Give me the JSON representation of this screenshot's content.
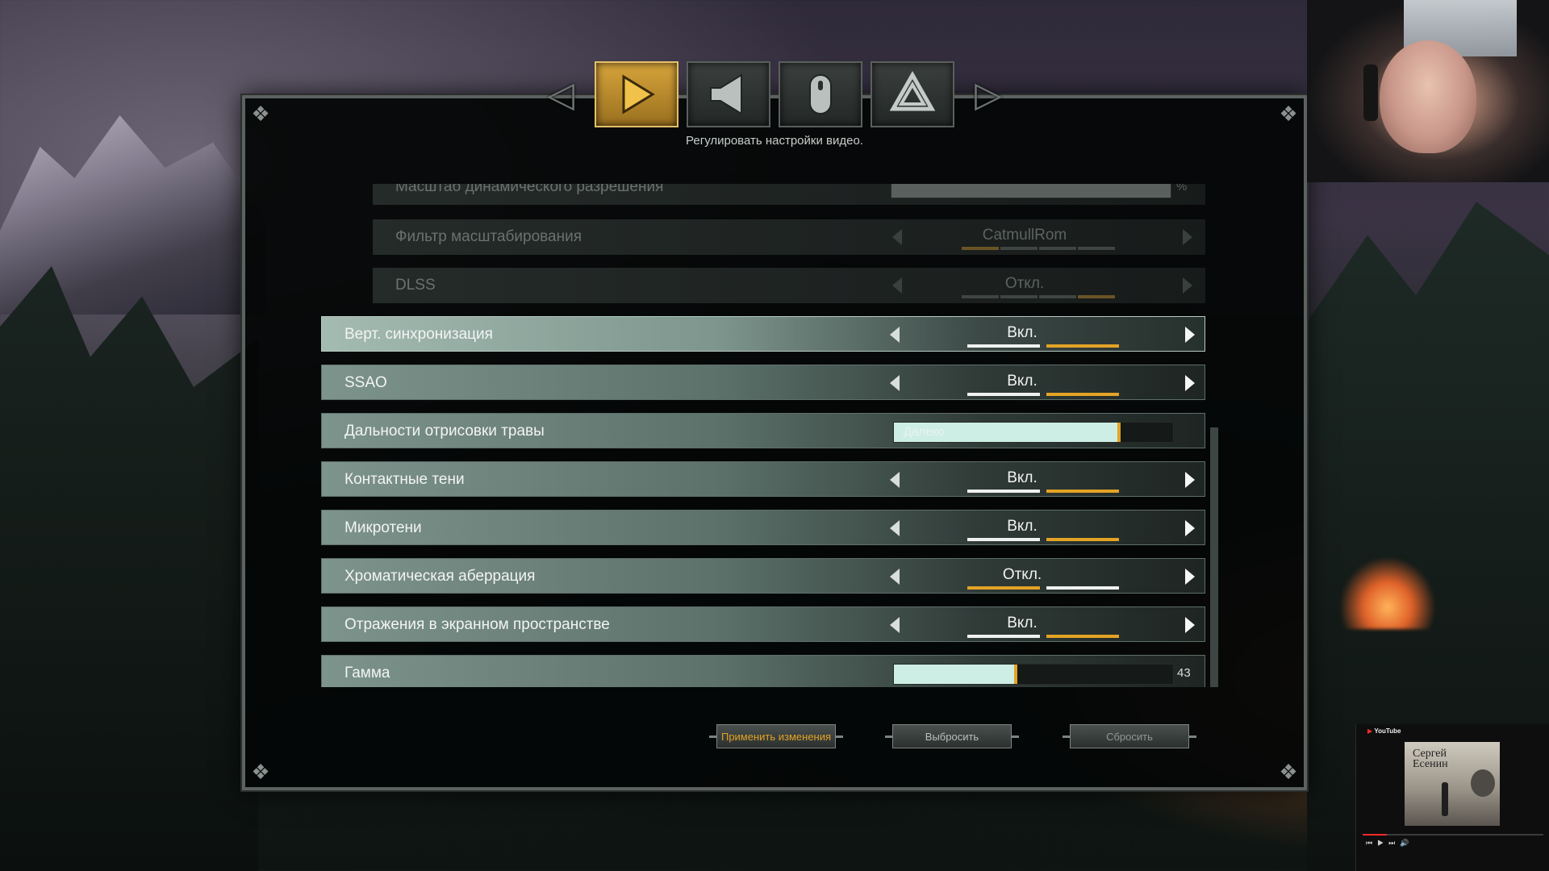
{
  "topnav": {
    "tabs": [
      {
        "name": "video",
        "icon": "play-icon",
        "active": true
      },
      {
        "name": "audio",
        "icon": "speaker-icon",
        "active": false
      },
      {
        "name": "controls",
        "icon": "mouse-icon",
        "active": false
      },
      {
        "name": "game",
        "icon": "valknut-icon",
        "active": false
      }
    ],
    "subtitle": "Регулировать настройки видео."
  },
  "settings": [
    {
      "label": "Масштаб динамического разрешения",
      "type": "slider",
      "fraction": 1.0,
      "value_text": "%",
      "dim": true
    },
    {
      "label": "Фильтр масштабирования",
      "type": "option",
      "value": "CatmullRom",
      "dim": true
    },
    {
      "label": "DLSS",
      "type": "option",
      "value": "Откл.",
      "dim": true
    },
    {
      "label": "Верт. синхронизация",
      "type": "option",
      "value": "Вкл.",
      "on": true,
      "highlight": true
    },
    {
      "label": "SSAO",
      "type": "option",
      "value": "Вкл.",
      "on": true
    },
    {
      "label": "Дальности отрисовки травы",
      "type": "slider",
      "fraction": 0.8,
      "value_text": "Далеко"
    },
    {
      "label": "Контактные тени",
      "type": "option",
      "value": "Вкл.",
      "on": true
    },
    {
      "label": "Микротени",
      "type": "option",
      "value": "Вкл.",
      "on": true
    },
    {
      "label": "Хроматическая аберрация",
      "type": "option",
      "value": "Откл.",
      "on": false
    },
    {
      "label": "Отражения в экранном пространстве",
      "type": "option",
      "value": "Вкл.",
      "on": true
    },
    {
      "label": "Гамма",
      "type": "slider",
      "fraction": 0.43,
      "value_text": "43"
    }
  ],
  "buttons": {
    "apply": "Применить изменения",
    "discard": "Выбросить",
    "reset": "Сбросить"
  },
  "player": {
    "brand": "YouTube",
    "cover_title": "Сергей\nЕсенин"
  },
  "colors": {
    "accent": "#e3a325",
    "row_light": "#7d948c",
    "slider_fill": "#cdeee4"
  }
}
